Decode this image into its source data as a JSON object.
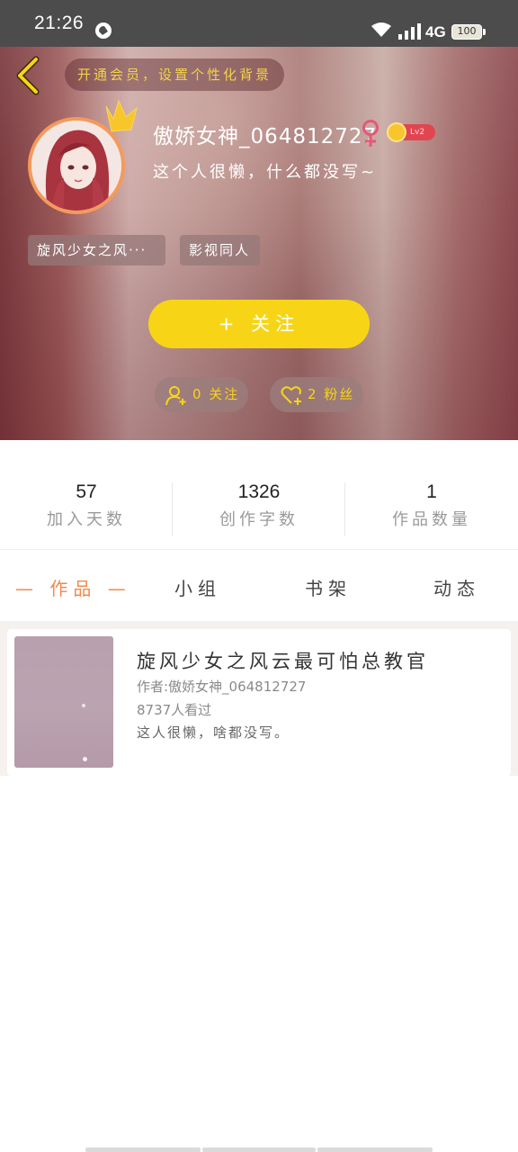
{
  "status_bar": {
    "time": "21:26",
    "network": "4G",
    "battery": "100"
  },
  "header": {
    "vip_banner": "开通会员，设置个性化背景"
  },
  "profile": {
    "username": "傲娇女神_064812727",
    "gender_icon": "female-icon",
    "level": "Lv2",
    "bio": "这个人很懒，什么都没写~",
    "tags": [
      "旋风少女之风···",
      "影视同人"
    ],
    "follow_button": "+ 关注",
    "following": "0 关注",
    "fans": "2 粉丝"
  },
  "stats": [
    {
      "value": "57",
      "label": "加入天数"
    },
    {
      "value": "1326",
      "label": "创作字数"
    },
    {
      "value": "1",
      "label": "作品数量"
    }
  ],
  "tabs": [
    {
      "label": "— 作品 —",
      "active": true
    },
    {
      "label": "小组",
      "active": false
    },
    {
      "label": "书架",
      "active": false
    },
    {
      "label": "动态",
      "active": false
    }
  ],
  "works": [
    {
      "title": "旋风少女之风云最可怕总教官",
      "author": "作者:傲娇女神_064812727",
      "views": "8737人看过",
      "description": "这人很懒，啥都没写。"
    }
  ],
  "colors": {
    "accent_yellow": "#f7d516",
    "active_tab": "#f08a4b",
    "avatar_border": "#f49a5b",
    "level_badge": "#e0464f"
  }
}
